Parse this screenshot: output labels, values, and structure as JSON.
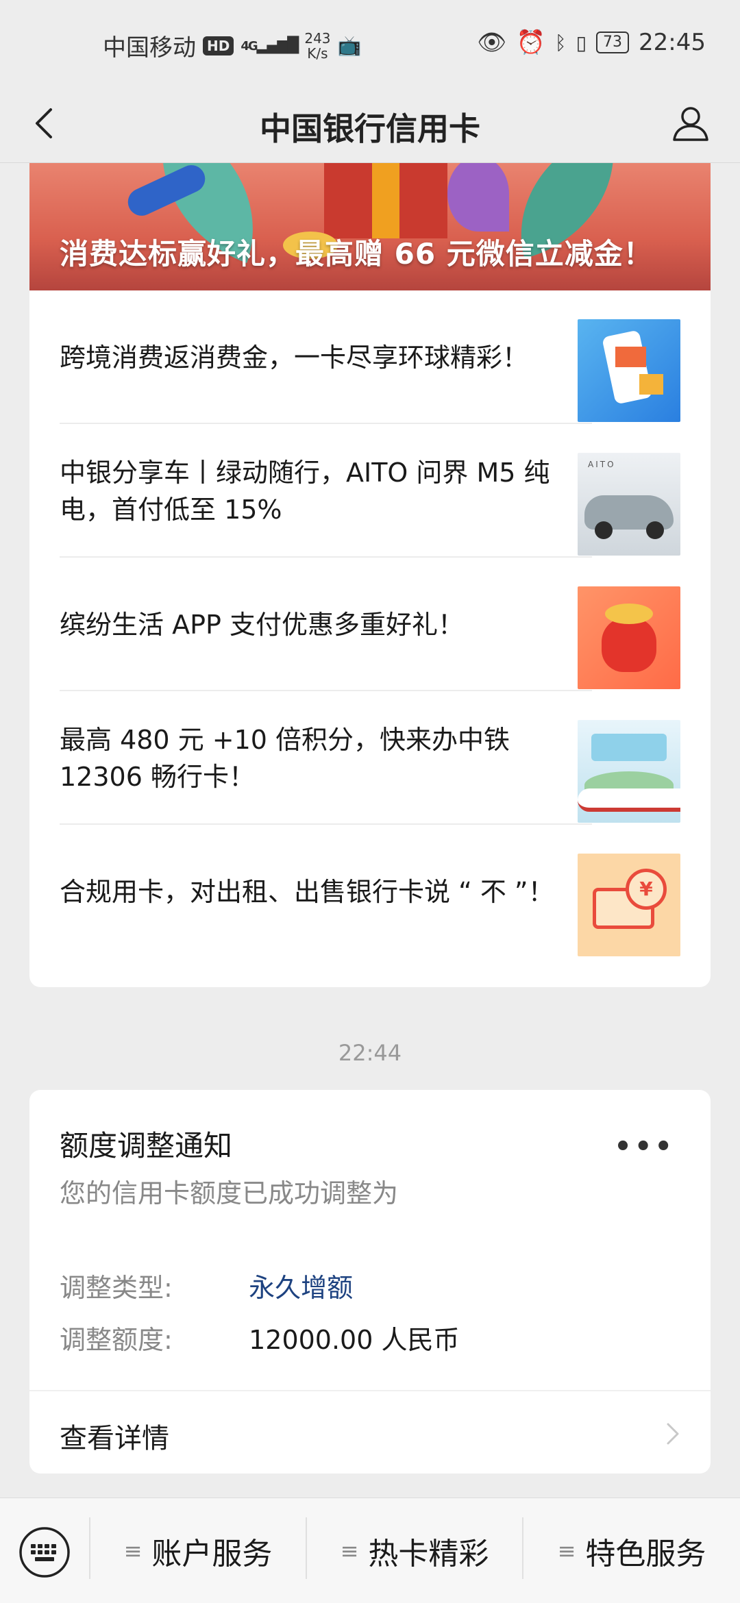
{
  "status_bar": {
    "carrier": "中国移动",
    "hd": "HD",
    "network": "4G",
    "speed_value": "243",
    "speed_unit": "K/s",
    "battery": "73",
    "time": "22:45"
  },
  "nav": {
    "title": "中国银行信用卡"
  },
  "article": {
    "banner_text": "消费达标赢好礼，最高赠 66 元微信立减金！",
    "items": [
      {
        "text": "跨境消费返消费金，一卡尽享环球精彩！",
        "thumb_icon": "shopping-phone-icon"
      },
      {
        "text": "中银分享车丨绿动随行，AITO 问界 M5 纯电，首付低至 15%",
        "thumb_icon": "car-image",
        "thumb_brand": "AITO"
      },
      {
        "text": "缤纷生活 APP 支付优惠多重好礼！",
        "thumb_icon": "money-bag-icon"
      },
      {
        "text": "最高 480 元 +10 倍积分，快来办中铁 12306 畅行卡！",
        "thumb_icon": "train-card-image"
      },
      {
        "text": "合规用卡，对出租、出售银行卡说 “ 不 ”！",
        "thumb_icon": "yen-card-icon"
      }
    ]
  },
  "timestamp": "22:44",
  "notification": {
    "title": "额度调整通知",
    "more": "•••",
    "subtitle": "您的信用卡额度已成功调整为",
    "rows": [
      {
        "label": "调整类型:",
        "value": "永久增额"
      },
      {
        "label": "调整额度:",
        "value": "12000.00 人民币"
      }
    ],
    "detail": "查看详情"
  },
  "bottom_menu": {
    "items": [
      {
        "label": "账户服务"
      },
      {
        "label": "热卡精彩"
      },
      {
        "label": "特色服务"
      }
    ],
    "menu_glyph": "≡"
  },
  "colors": {
    "background": "#ededed",
    "link_blue": "#1d4280",
    "banner_red": "#d9604f"
  }
}
